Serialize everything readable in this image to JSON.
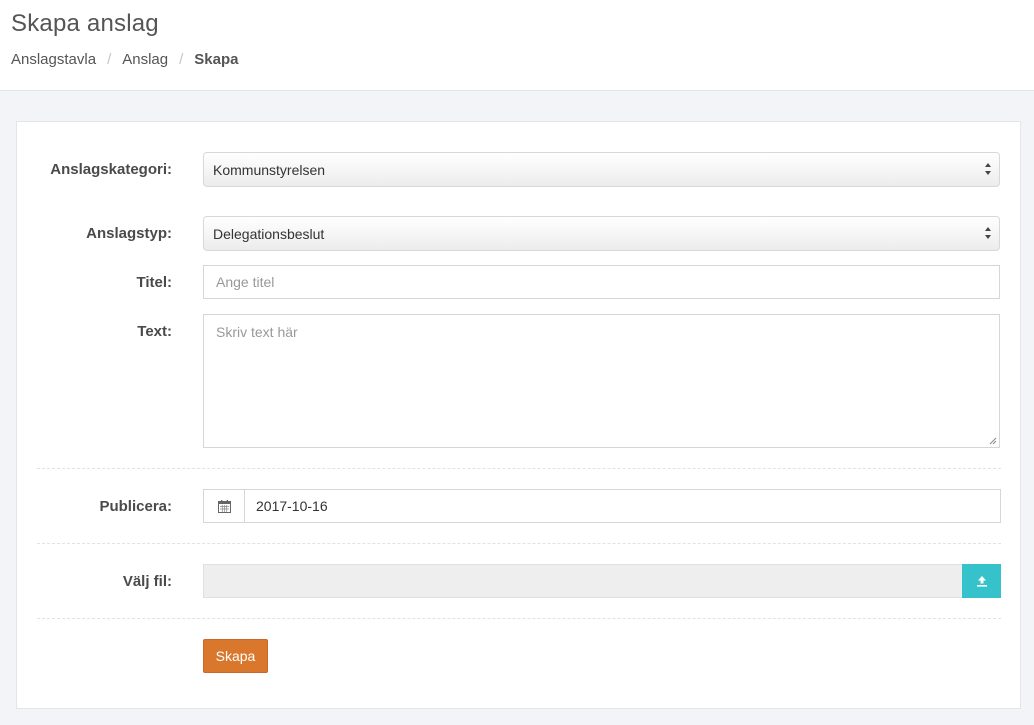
{
  "header": {
    "title": "Skapa anslag",
    "breadcrumb": [
      "Anslagstavla",
      "Anslag",
      "Skapa"
    ]
  },
  "form": {
    "category": {
      "label": "Anslagskategori:",
      "selected": "Kommunstyrelsen"
    },
    "type": {
      "label": "Anslagstyp:",
      "selected": "Delegationsbeslut"
    },
    "title": {
      "label": "Titel:",
      "placeholder": "Ange titel"
    },
    "text": {
      "label": "Text:",
      "placeholder": "Skriv text här"
    },
    "publish": {
      "label": "Publicera:",
      "value": "2017-10-16",
      "icon": "calendar-icon"
    },
    "file": {
      "label": "Välj fil:",
      "icon": "upload-icon"
    },
    "submit_label": "Skapa"
  },
  "colors": {
    "accent_orange": "#d9772c",
    "upload_teal": "#36c2cb",
    "page_bg": "#f3f4f8"
  }
}
